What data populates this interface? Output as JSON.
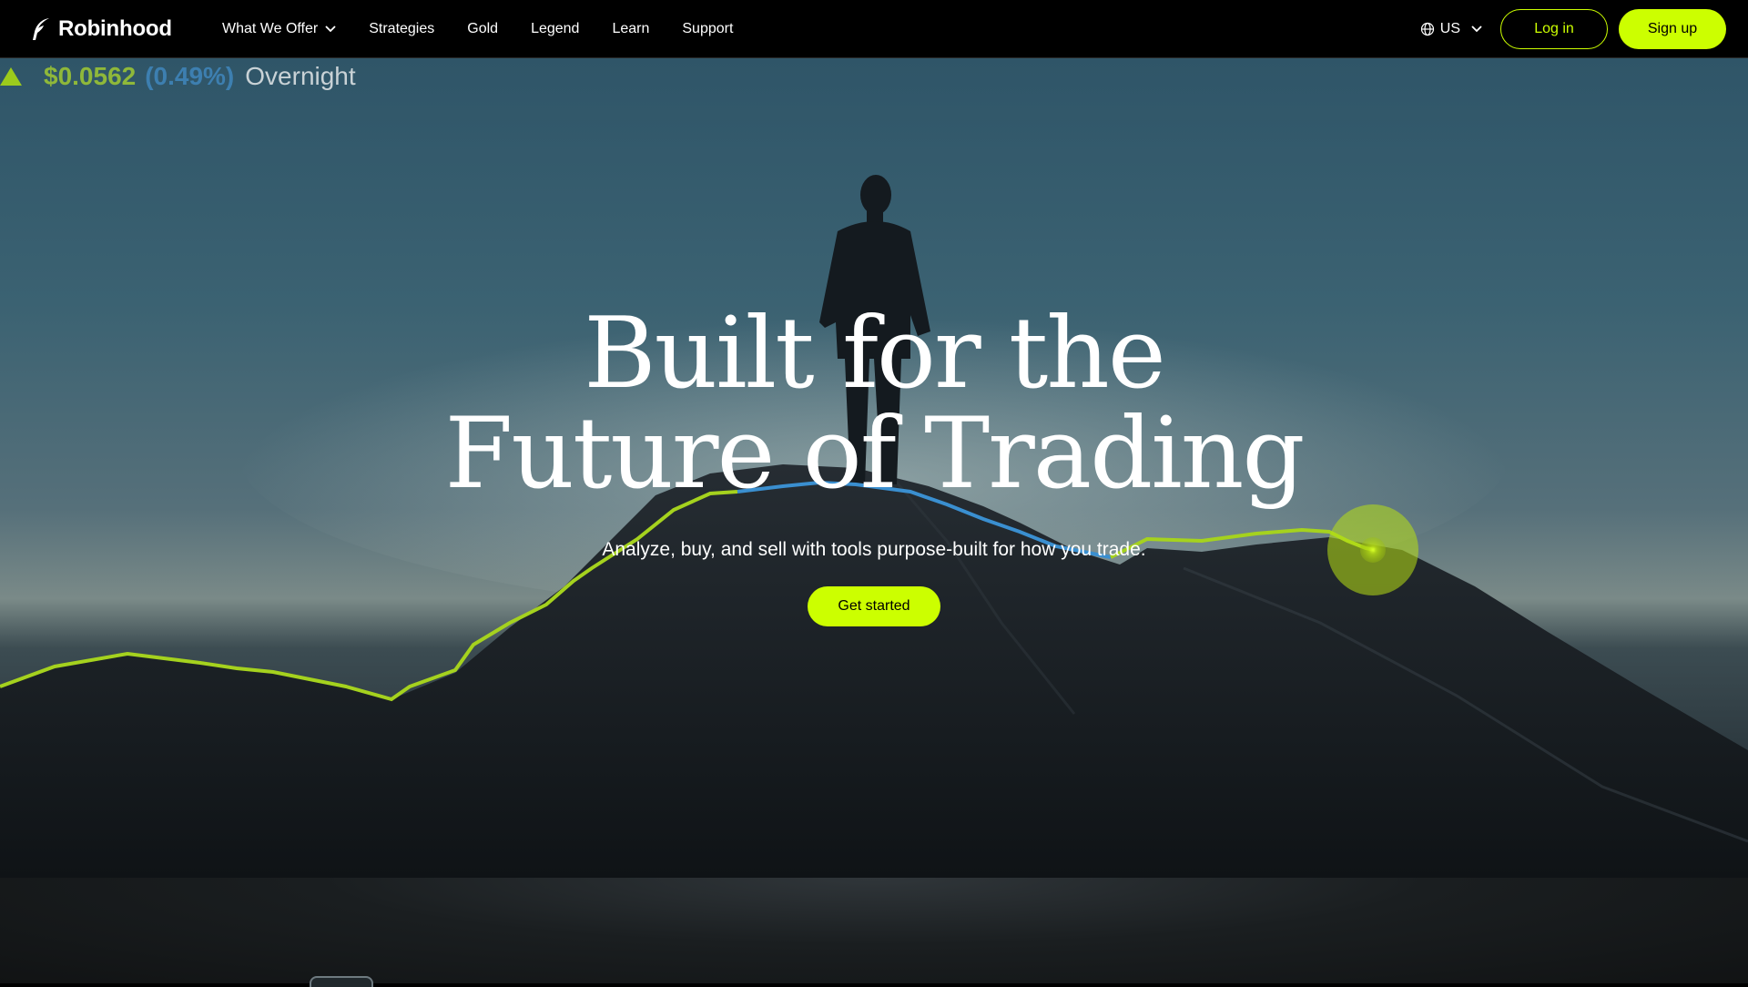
{
  "nav": {
    "brand": "Robinhood",
    "links": [
      {
        "label": "What We Offer",
        "has_dropdown": true
      },
      {
        "label": "Strategies"
      },
      {
        "label": "Gold"
      },
      {
        "label": "Legend"
      },
      {
        "label": "Learn"
      },
      {
        "label": "Support"
      }
    ],
    "locale": "US",
    "login_label": "Log in",
    "signup_label": "Sign up"
  },
  "ticker": {
    "price": "$0.0562",
    "change": "(0.49%)",
    "session": "Overnight",
    "direction": "up"
  },
  "hero": {
    "headline_line1": "Built for the",
    "headline_line2": "Future of Trading",
    "subhead": "Analyze, buy, and sell with tools purpose-built for how you trade.",
    "cta_label": "Get started"
  },
  "colors": {
    "accent": "#ccff00",
    "ticker_up": "#9ccb1c",
    "ticker_pct": "#3d7fb0",
    "line_blue": "#3a8fd0"
  },
  "icons": {
    "logo": "robinhood-feather-icon",
    "globe": "globe-icon",
    "chevron": "chevron-down-icon",
    "up": "triangle-up-icon"
  }
}
